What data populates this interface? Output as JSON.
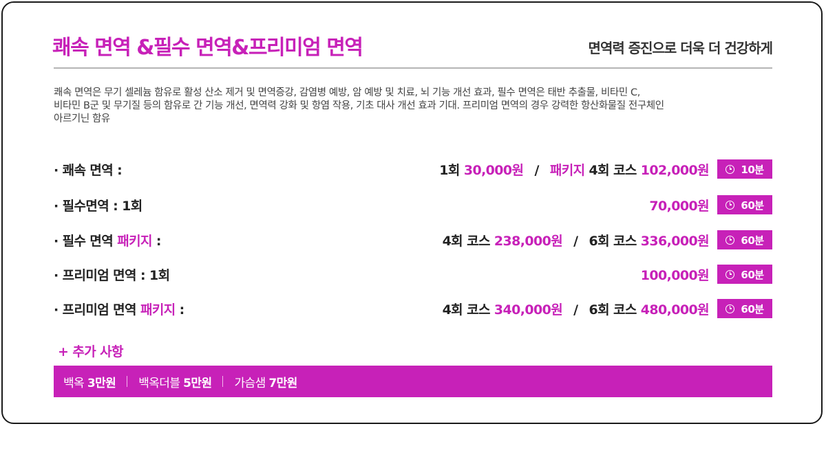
{
  "header": {
    "title": "쾌속 면역 &필수 면역&프리미엄 면역",
    "subtitle": "면역력 증진으로 더욱 더 건강하게"
  },
  "description": [
    "쾌속 면역은 무기 셀레늄 함유로 활성 산소 제거 및 면역증강, 감염병 예방, 암 예방 및 치료, 뇌 기능 개선 효과, 필수 면역은 태반 추출물, 비타민 C,",
    "비타민 B군 및 무기질 등의 함유로 간 기능 개선, 면역력 강화 및 항염 작용, 기초 대사 개선 효과 기대. 프리미엄 면역의 경우 강력한 항산화물질 전구체인",
    "아르기닌 함유"
  ],
  "prices": [
    {
      "label": "· 쾌속 면역 :",
      "label_pink": "",
      "label_tail": "",
      "left_qty": "1회",
      "left_price": "30,000원",
      "separator": "/",
      "right_prefix": "패키지",
      "right_qty": "4회 코스",
      "right_price": "102,000원",
      "duration": "10분"
    },
    {
      "label": "· 필수면역 : 1회",
      "label_pink": "",
      "label_tail": "",
      "left_qty": "",
      "left_price": "",
      "separator": "",
      "right_prefix": "",
      "right_qty": "",
      "right_price": "70,000원",
      "duration": "60분"
    },
    {
      "label": "· 필수 면역 ",
      "label_pink": "패키지",
      "label_tail": " :",
      "left_qty": "4회 코스",
      "left_price": "238,000원",
      "separator": "/",
      "right_prefix": "",
      "right_qty": "6회 코스",
      "right_price": "336,000원",
      "duration": "60분"
    },
    {
      "label": "· 프리미엄 면역 :  1회",
      "label_pink": "",
      "label_tail": "",
      "left_qty": "",
      "left_price": "",
      "separator": "",
      "right_prefix": "",
      "right_qty": "",
      "right_price": "100,000원",
      "duration": "60분"
    },
    {
      "label": "· 프리미엄 면역 ",
      "label_pink": "패키지",
      "label_tail": " :",
      "left_qty": "4회 코스",
      "left_price": "340,000원",
      "separator": "/",
      "right_prefix": "",
      "right_qty": "6회 코스",
      "right_price": "480,000원",
      "duration": "60분"
    }
  ],
  "extras": {
    "title": "+ 추가 사항",
    "items": [
      {
        "name": "백옥 ",
        "price": "3만원"
      },
      {
        "name": "백옥더블 ",
        "price": "5만원"
      },
      {
        "name": "가슴샘 ",
        "price": "7만원"
      }
    ]
  },
  "colors": {
    "accent": "#c721b8",
    "text": "#222222",
    "rule": "#b5b5b5"
  },
  "icons": {
    "duration": "clock-icon"
  }
}
